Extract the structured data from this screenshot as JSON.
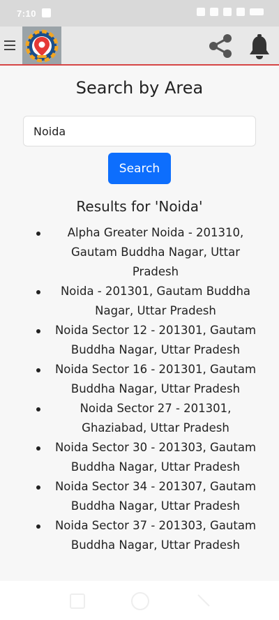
{
  "status_bar": {
    "time": "7:10"
  },
  "header": {
    "menu_icon": "hamburger-icon",
    "logo_icon": "location-pin-logo",
    "share_icon": "share-icon",
    "bell_icon": "bell-icon",
    "accent_color": "#d64545"
  },
  "main": {
    "title": "Search by Area",
    "search": {
      "value": "Noida",
      "button_label": "Search"
    },
    "results_heading": "Results for 'Noida'",
    "results": [
      "Alpha Greater Noida - 201310, Gautam Buddha Nagar, Uttar Pradesh",
      "Noida - 201301, Gautam Buddha Nagar, Uttar Pradesh",
      "Noida Sector 12 - 201301, Gautam Buddha Nagar, Uttar Pradesh",
      "Noida Sector 16 - 201301, Gautam Buddha Nagar, Uttar Pradesh",
      "Noida Sector 27 - 201301, Ghaziabad, Uttar Pradesh",
      "Noida Sector 30 - 201303, Gautam Buddha Nagar, Uttar Pradesh",
      "Noida Sector 34 - 201307, Gautam Buddha Nagar, Uttar Pradesh",
      "Noida Sector 37 - 201303, Gautam Buddha Nagar, Uttar Pradesh"
    ],
    "button_color": "#0d6efd"
  },
  "nav_bar": {
    "recents_icon": "recents-icon",
    "home_icon": "home-icon",
    "back_icon": "back-icon"
  }
}
